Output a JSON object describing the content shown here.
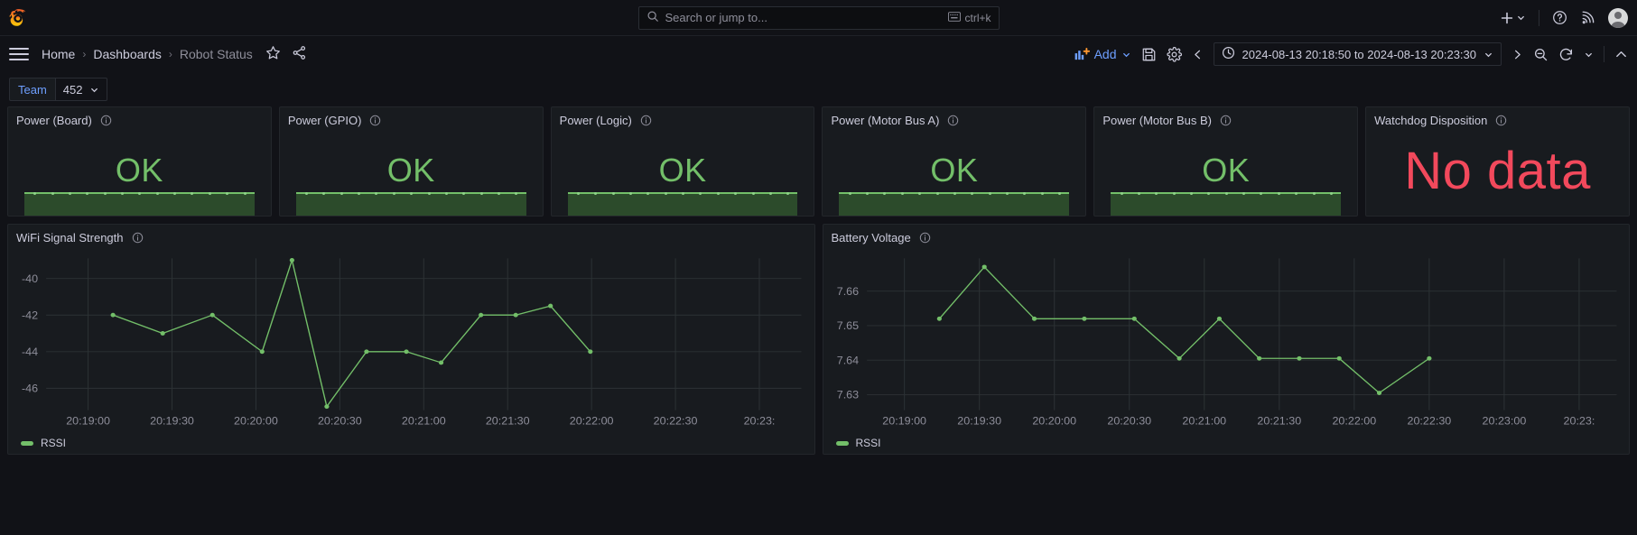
{
  "topnav": {
    "logo_name": "grafana-logo",
    "search": {
      "placeholder": "Search or jump to...",
      "shortcut": "ctrl+k"
    },
    "actions": {
      "add_label": "+",
      "help_label": "?",
      "news_label": "news",
      "avatar_label": "profile"
    }
  },
  "breadcrumb": {
    "items": [
      {
        "label": "Home",
        "current": false
      },
      {
        "label": "Dashboards",
        "current": false
      },
      {
        "label": "Robot Status",
        "current": true
      }
    ],
    "separator": "›"
  },
  "toolbar": {
    "add_label": "Add",
    "time_range": "2024-08-13 20:18:50 to 2024-08-13 20:23:30"
  },
  "variables": [
    {
      "label": "Team",
      "value": "452"
    }
  ],
  "stat_panels": [
    {
      "title": "Power (Board)",
      "value": "OK",
      "state": "ok"
    },
    {
      "title": "Power (GPIO)",
      "value": "OK",
      "state": "ok"
    },
    {
      "title": "Power (Logic)",
      "value": "OK",
      "state": "ok"
    },
    {
      "title": "Power (Motor Bus A)",
      "value": "OK",
      "state": "ok"
    },
    {
      "title": "Power (Motor Bus B)",
      "value": "OK",
      "state": "ok"
    },
    {
      "title": "Watchdog Disposition",
      "value": "No data",
      "state": "nodata"
    }
  ],
  "colors": {
    "green": "#73bf69",
    "red": "#f2495c",
    "blue": "#6e9fff",
    "panel_bg": "#181b1f",
    "page_bg": "#111217",
    "grid": "#2c3235",
    "text": "#ccccdc",
    "text_dim": "#8e8e9a",
    "sparkline_fill": "#2c4b2b"
  },
  "chart_data": [
    {
      "type": "line",
      "panel_title": "WiFi Signal Strength",
      "title": "WiFi Signal Strength",
      "xlabel": "",
      "ylabel": "",
      "ylim": [
        -47.2,
        -38.9
      ],
      "yticks": [
        -40,
        -42,
        -44,
        -46
      ],
      "ytick_labels": [
        "-40",
        "-42",
        "-44",
        "-46"
      ],
      "xticks": [
        "20:19:00",
        "20:19:30",
        "20:20:00",
        "20:20:30",
        "20:21:00",
        "20:21:30",
        "20:22:00",
        "20:22:30",
        "20:23:"
      ],
      "grid": true,
      "legend": [
        {
          "name": "RSSI",
          "color": "#73bf69"
        }
      ],
      "legend_position": "bottom",
      "series": [
        {
          "name": "RSSI",
          "color": "#73bf69",
          "x": [
            "20:19:10",
            "20:19:30",
            "20:19:50",
            "20:20:10",
            "20:20:22",
            "20:20:36",
            "20:20:52",
            "20:21:08",
            "20:21:22",
            "20:21:38",
            "20:21:52",
            "20:22:06",
            "20:22:22"
          ],
          "values": [
            -42,
            -43,
            -42,
            -44,
            -39,
            -47,
            -44,
            -44,
            -44.6,
            -42,
            -42,
            -41.5,
            -44
          ]
        }
      ]
    },
    {
      "type": "line",
      "panel_title": "Battery Voltage",
      "title": "Battery Voltage",
      "xlabel": "",
      "ylabel": "",
      "ylim": [
        7.6255,
        7.6695
      ],
      "yticks": [
        7.66,
        7.65,
        7.64,
        7.63
      ],
      "ytick_labels": [
        "7.66",
        "7.65",
        "7.64",
        "7.63"
      ],
      "xticks": [
        "20:19:00",
        "20:19:30",
        "20:20:00",
        "20:20:30",
        "20:21:00",
        "20:21:30",
        "20:22:00",
        "20:22:30",
        "20:23:00",
        "20:23:"
      ],
      "grid": true,
      "legend": [
        {
          "name": "RSSI",
          "color": "#73bf69"
        }
      ],
      "legend_position": "bottom",
      "series": [
        {
          "name": "RSSI",
          "color": "#73bf69",
          "x": [
            "20:19:14",
            "20:19:32",
            "20:19:52",
            "20:20:12",
            "20:20:32",
            "20:20:50",
            "20:21:06",
            "20:21:22",
            "20:21:38",
            "20:21:54",
            "20:22:10",
            "20:22:30"
          ],
          "values": [
            7.652,
            7.667,
            7.652,
            7.652,
            7.652,
            7.6405,
            7.652,
            7.6405,
            7.6405,
            7.6405,
            7.6305,
            7.6405
          ]
        }
      ]
    }
  ]
}
